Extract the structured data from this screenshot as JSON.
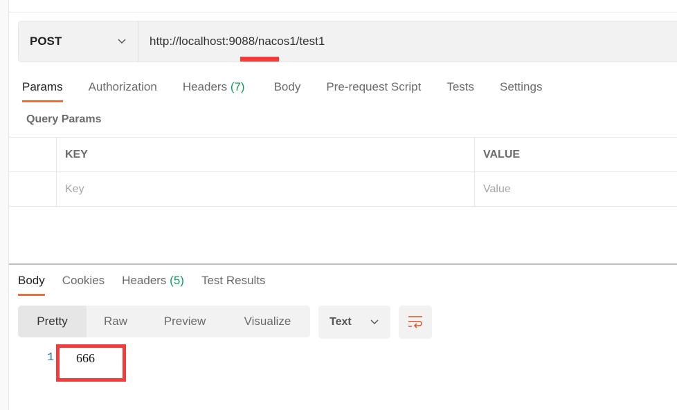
{
  "request": {
    "method": "POST",
    "url": "http://localhost:9088/nacos1/test1"
  },
  "request_tabs": [
    {
      "label": "Params"
    },
    {
      "label": "Authorization"
    },
    {
      "label": "Headers",
      "count": "(7)"
    },
    {
      "label": "Body"
    },
    {
      "label": "Pre-request Script"
    },
    {
      "label": "Tests"
    },
    {
      "label": "Settings"
    }
  ],
  "query_params": {
    "title": "Query Params",
    "key_header": "KEY",
    "value_header": "VALUE",
    "key_placeholder": "Key",
    "value_placeholder": "Value"
  },
  "response_tabs": [
    {
      "label": "Body"
    },
    {
      "label": "Cookies"
    },
    {
      "label": "Headers",
      "count": "(5)"
    },
    {
      "label": "Test Results"
    }
  ],
  "view_modes": [
    "Pretty",
    "Raw",
    "Preview",
    "Visualize"
  ],
  "format": "Text",
  "response": {
    "line_number": "1",
    "content": "666"
  },
  "colors": {
    "accent": "#f26b3a",
    "highlight": "#f53a3a",
    "count": "#0f9d58"
  }
}
